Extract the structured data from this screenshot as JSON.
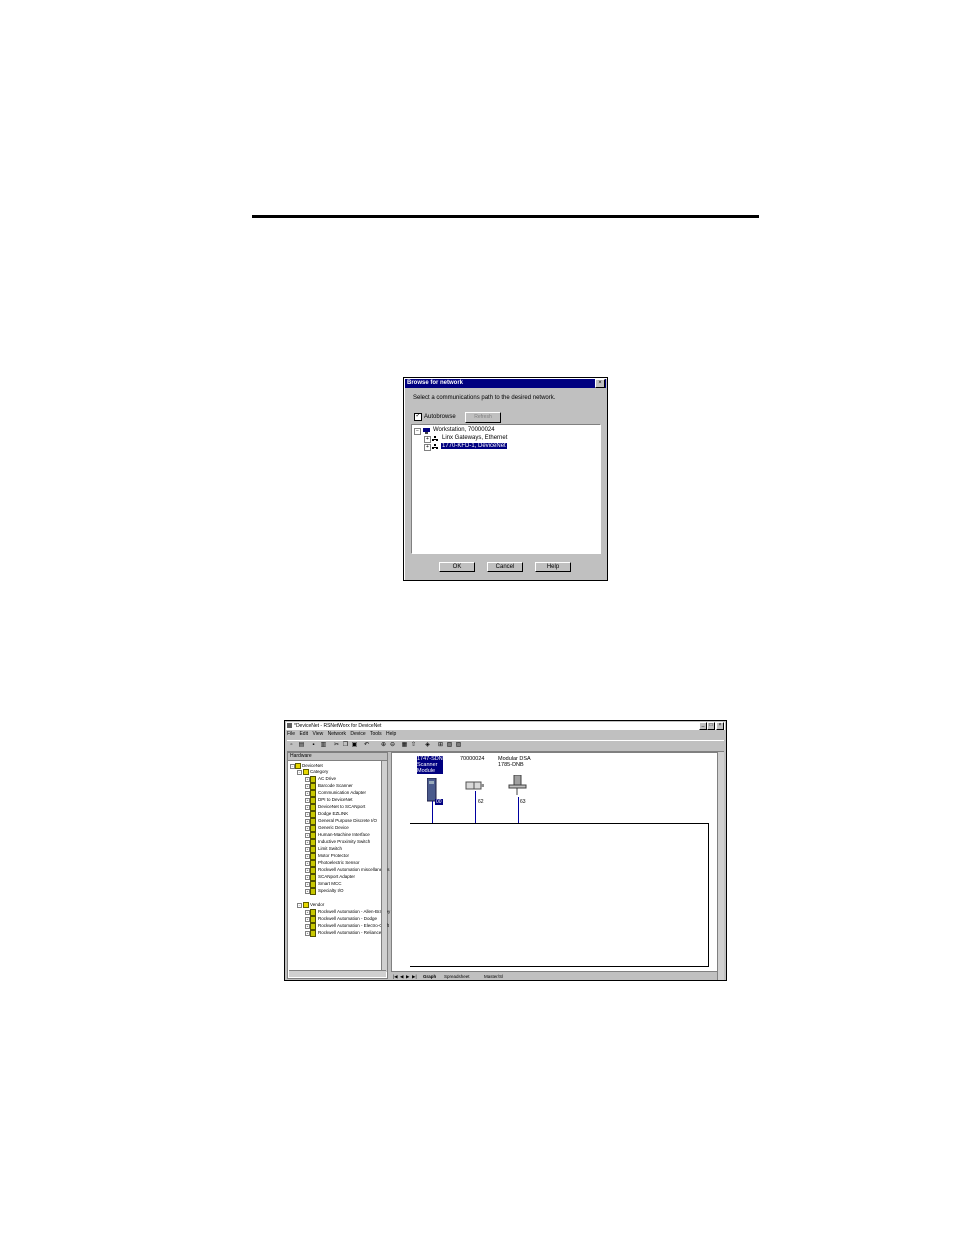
{
  "dialog": {
    "title": "Browse for network",
    "close_glyph": "×",
    "prompt": "Select a communications path to the desired network.",
    "autobrowse_label": "Autobrowse",
    "autobrowse_checked": "✓",
    "refresh_label": "Refresh",
    "tree": [
      {
        "label": "Workstation, 70000024",
        "expander": "⊟"
      },
      {
        "label": "Linx Gateways, Ethernet",
        "expander": "⊞"
      },
      {
        "label": "1770-KFD-1, DeviceNet",
        "expander": "⊞",
        "selected": true
      }
    ],
    "buttons": {
      "ok": "OK",
      "cancel": "Cancel",
      "help": "Help"
    }
  },
  "window": {
    "title": "*DeviceNet - RSNetWorx for DeviceNet",
    "controls": [
      "_",
      "□",
      "×"
    ],
    "menu": [
      "File",
      "Edit",
      "View",
      "Network",
      "Device",
      "Tools",
      "Help"
    ],
    "hardware_header": "Hardware",
    "hardware_tree": {
      "root": "DeviceNet",
      "category": "Category",
      "category_items": [
        "AC Drive",
        "Barcode Scanner",
        "Communication Adapter",
        "DPI to DeviceNet",
        "DeviceNet to SCANport",
        "Dodge EZLINK",
        "General Purpose Discrete I/O",
        "Generic Device",
        "Human-Machine Interface",
        "Inductive Proximity Switch",
        "Limit Switch",
        "Motor Protector",
        "Photoelectric Sensor",
        "Rockwell Automation miscellaneous",
        "SCANport Adapter",
        "Smart MCC",
        "Specialty I/O"
      ],
      "vendor": "Vendor",
      "vendor_items": [
        "Rockwell Automation - Allen-Bradley",
        "Rockwell Automation - Dodge",
        "Rockwell Automation - Electro-Craft",
        "Rockwell Automation - Reliance"
      ]
    },
    "devices": [
      {
        "label": "1747-SDN\nScanner\nModule",
        "address": "00",
        "selected": true
      },
      {
        "label": "70000024",
        "address": "62"
      },
      {
        "label": "Modular DSA\n1785-DNB",
        "address": "63"
      }
    ],
    "tabs": [
      "Graph",
      "Spreadsheet",
      "Master/Sl"
    ],
    "tab_nav": [
      "|◀",
      "◀",
      "▶",
      "▶|"
    ]
  }
}
